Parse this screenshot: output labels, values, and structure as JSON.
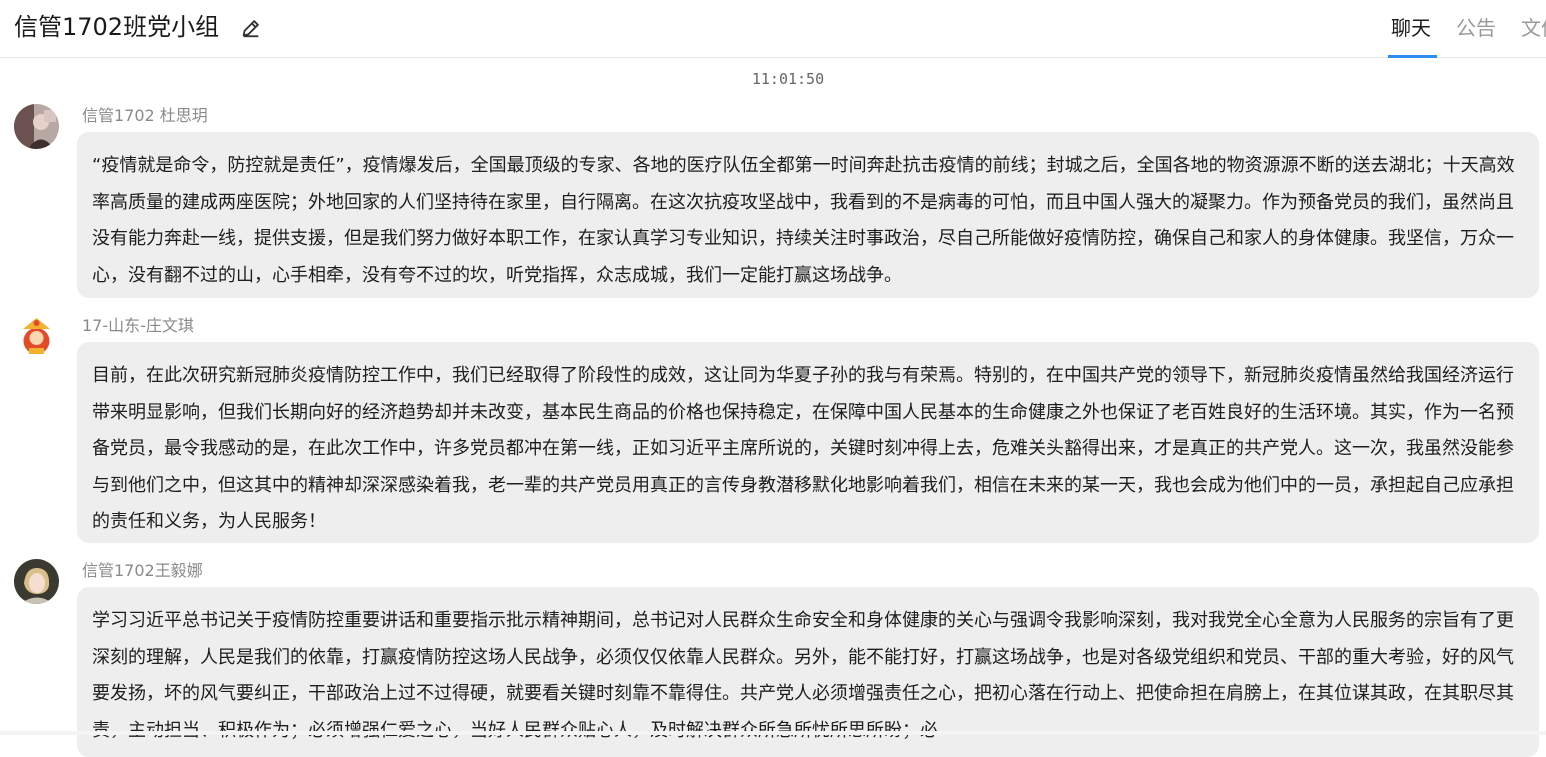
{
  "header": {
    "title": "信管1702班党小组",
    "edit_icon": "edit-pencil-icon",
    "tabs": [
      {
        "label": "聊天",
        "active": true
      },
      {
        "label": "公告",
        "active": false
      },
      {
        "label": "文件",
        "active": false
      }
    ],
    "accent_color": "#2d8cf0"
  },
  "chat": {
    "timestamp": "11:01:50",
    "messages": [
      {
        "sender": "信管1702 杜思玥",
        "text": "“疫情就是命令，防控就是责任”，疫情爆发后，全国最顶级的专家、各地的医疗队伍全都第一时间奔赴抗击疫情的前线；封城之后，全国各地的物资源源不断的送去湖北；十天高效率高质量的建成两座医院；外地回家的人们坚持待在家里，自行隔离。在这次抗疫攻坚战中，我看到的不是病毒的可怕，而且中国人强大的凝聚力。作为预备党员的我们，虽然尚且没有能力奔赴一线，提供支援，但是我们努力做好本职工作，在家认真学习专业知识，持续关注时事政治，尽自己所能做好疫情防控，确保自己和家人的身体健康。我坚信，万众一心，没有翻不过的山，心手相牵，没有夸不过的坎，听党指挥，众志成城，我们一定能打赢这场战争。"
      },
      {
        "sender": "17-山东-庄文琪",
        "text": "目前，在此次研究新冠肺炎疫情防控工作中，我们已经取得了阶段性的成效，这让同为华夏子孙的我与有荣焉。特别的，在中国共产党的领导下，新冠肺炎疫情虽然给我国经济运行带来明显影响，但我们长期向好的经济趋势却并未改变，基本民生商品的价格也保持稳定，在保障中国人民基本的生命健康之外也保证了老百姓良好的生活环境。其实，作为一名预备党员，最令我感动的是，在此次工作中，许多党员都冲在第一线，正如习近平主席所说的，关键时刻冲得上去，危难关头豁得出来，才是真正的共产党人。这一次，我虽然没能参与到他们之中，但这其中的精神却深深感染着我，老一辈的共产党员用真正的言传身教潜移默化地影响着我们，相信在未来的某一天，我也会成为他们中的一员，承担起自己应承担的责任和义务，为人民服务！"
      },
      {
        "sender": "信管1702王毅娜",
        "text": "学习习近平总书记关于疫情防控重要讲话和重要指示批示精神期间，总书记对人民群众生命安全和身体健康的关心与强调令我影响深刻，我对我党全心全意为人民服务的宗旨有了更深刻的理解，人民是我们的依靠，打赢疫情防控这场人民战争，必须仅仅依靠人民群众。另外，能不能打好，打赢这场战争，也是对各级党组织和党员、干部的重大考验，好的风气要发扬，坏的风气要纠正，干部政治上过不过得硬，就要看关键时刻靠不靠得住。共产党人必须增强责任之心，把初心落在行动上、把使命担在肩膀上，在其位谋其政，在其职尽其责，主动担当、积极作为；必须增强仁爱之心，当好人民群众贴心人，及时解决群众所急所忧所思所盼；必"
      }
    ]
  }
}
